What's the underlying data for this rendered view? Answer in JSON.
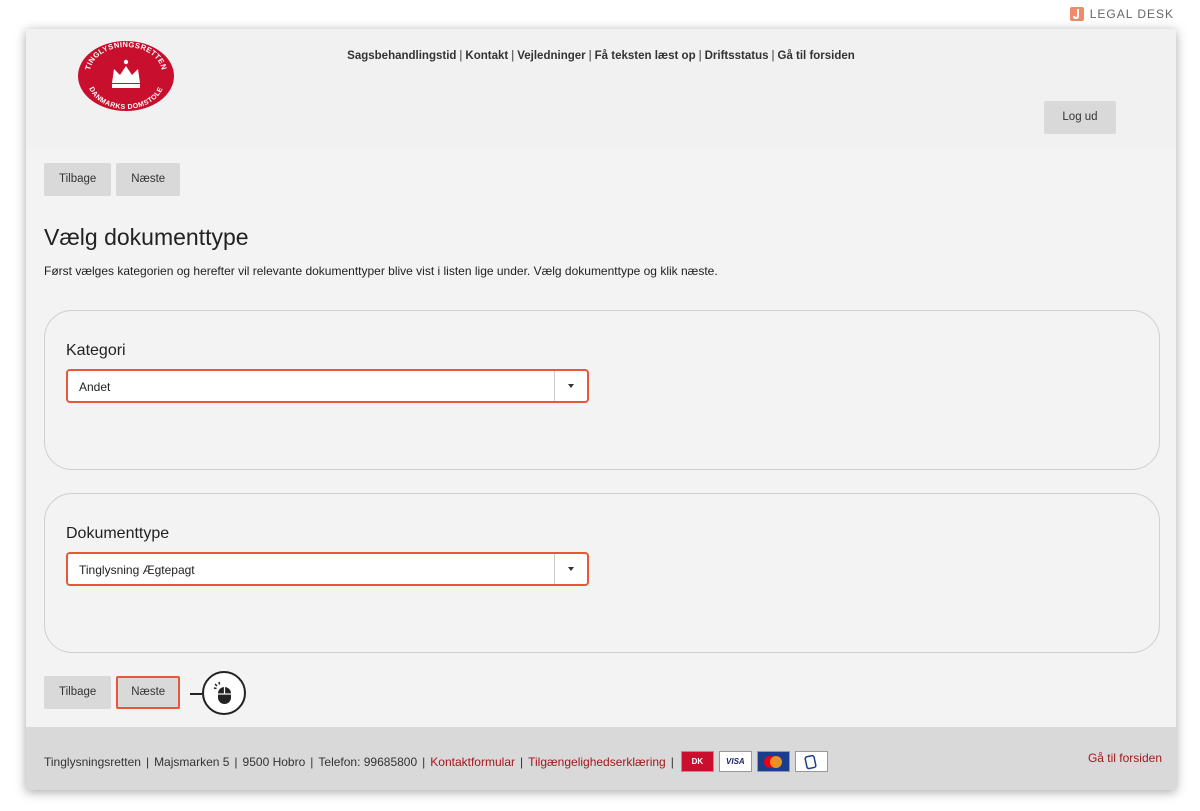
{
  "brand": {
    "name": "LEGAL DESK",
    "accent": "#ef8a6d",
    "icon": "legal-desk-icon"
  },
  "logo": {
    "text_top": "TINGLYSNINGSRETTEN",
    "text_bottom": "DANMARKS DOMSTOLE",
    "color": "#c8102e",
    "icon": "crown-icon"
  },
  "topnav": [
    "Sagsbehandlingstid",
    "Kontakt",
    "Vejledninger",
    "Få teksten læst op",
    "Driftsstatus",
    "Gå til forsiden"
  ],
  "header": {
    "logout_label": "Log ud"
  },
  "nav": {
    "back_label": "Tilbage",
    "next_label": "Næste"
  },
  "page": {
    "title": "Vælg dokumenttype",
    "intro": "Først vælges kategorien og herefter vil relevante dokumenttyper blive vist i listen lige under. Vælg dokumenttype og klik næste."
  },
  "kategori": {
    "label": "Kategori",
    "selected": "Andet"
  },
  "dokumenttype": {
    "label": "Dokumenttype",
    "selected": "Tinglysning Ægtepagt"
  },
  "highlight_color": "#e8573a",
  "footer": {
    "org": "Tinglysningsretten",
    "address": "Majsmarken 5",
    "city": "9500 Hobro",
    "phone": "Telefon: 99685800",
    "contact_link": "Kontaktformular",
    "accessibility_link": "Tilgængelighedserklæring",
    "home_link": "Gå til forsiden",
    "link_color": "#a0181d",
    "cards": [
      "dankort-icon",
      "visa-icon",
      "mastercard-icon",
      "mobilepay-icon"
    ]
  }
}
